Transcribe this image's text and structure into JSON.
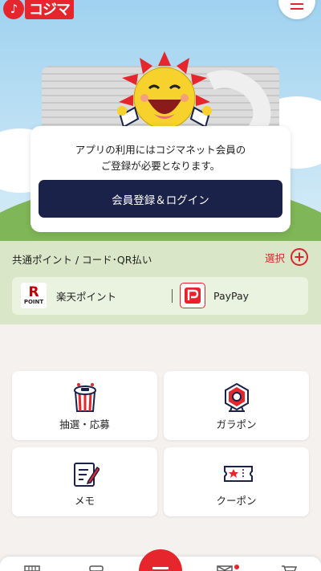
{
  "header": {
    "logo_text": "コジマ"
  },
  "notice": {
    "message_line1": "アプリの利用にはコジマネット会員の",
    "message_line2": "ご登録が必要となります。",
    "login_button": "会員登録＆ログイン"
  },
  "points": {
    "title": "共通ポイント / コード･QR払い",
    "select_label": "選択",
    "items": [
      {
        "logo_text": "R",
        "logo_sub": "POINT",
        "label": "楽天ポイント"
      },
      {
        "label": "PayPay"
      }
    ]
  },
  "menu_tiles": [
    {
      "label": "抽選・応募",
      "icon": "lottery-box-icon"
    },
    {
      "label": "ガラポン",
      "icon": "garapon-icon"
    },
    {
      "label": "メモ",
      "icon": "memo-icon"
    },
    {
      "label": "クーポン",
      "icon": "coupon-icon"
    }
  ],
  "colors": {
    "brand_red": "#e5262d",
    "navy": "#1a2249",
    "green": "#7fb657"
  }
}
